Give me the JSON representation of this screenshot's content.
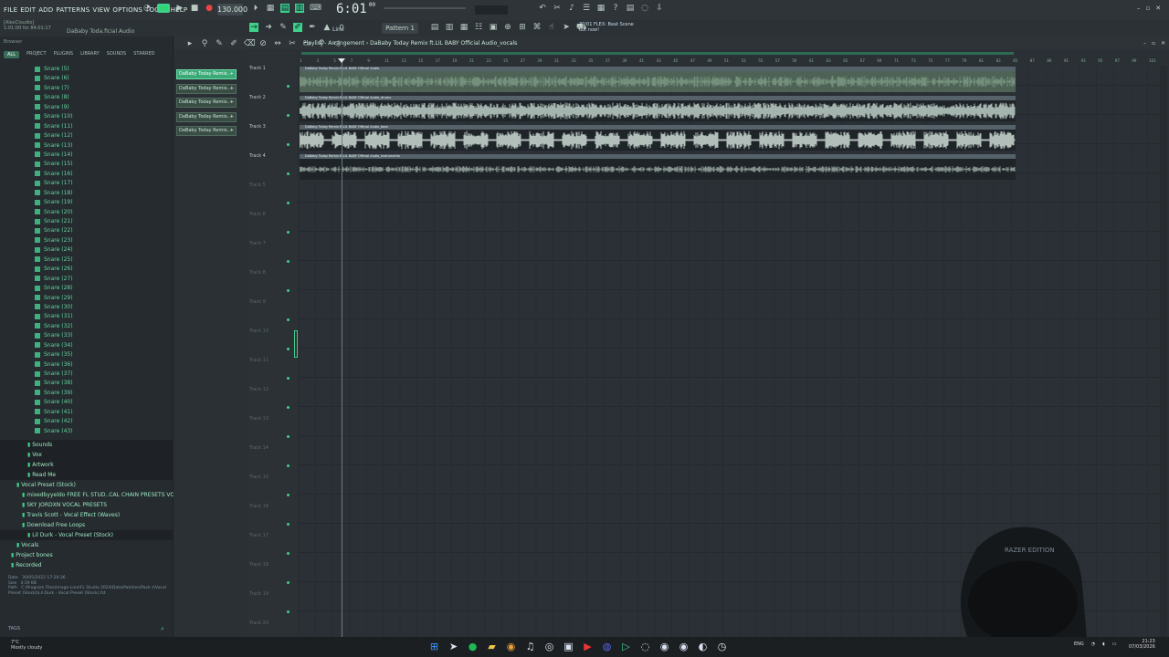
{
  "menu": [
    "FILE",
    "EDIT",
    "ADD",
    "PATTERNS",
    "VIEW",
    "OPTIONS",
    "TOOLS",
    "HELP"
  ],
  "tempo": "130.000",
  "clock": "6:01",
  "clock_sub": "00",
  "song_info": {
    "line1": "[AlexCloudio]",
    "line2": "1:01:00 for 84:01:17"
  },
  "song_name": "DaBaby Toda.ficial Audio",
  "pattern": "Pattern 1",
  "line_mode": "Line",
  "hint": {
    "line1": "30/01 FLEX: Beat Scene",
    "line2": "out now!"
  },
  "browser": {
    "title": "Browser",
    "tabs": [
      "ALL",
      "PROJECT",
      "PLUGINS",
      "LIBRARY",
      "SOUNDS",
      "STARRED"
    ],
    "snares": [
      "Snare (5)",
      "Snare (6)",
      "Snare (7)",
      "Snare (8)",
      "Snare (9)",
      "Snare (10)",
      "Snare (11)",
      "Snare (12)",
      "Snare (13)",
      "Snare (14)",
      "Snare (15)",
      "Snare (16)",
      "Snare (17)",
      "Snare (18)",
      "Snare (19)",
      "Snare (20)",
      "Snare (21)",
      "Snare (22)",
      "Snare (23)",
      "Snare (24)",
      "Snare (25)",
      "Snare (26)",
      "Snare (27)",
      "Snare (28)",
      "Snare (29)",
      "Snare (30)",
      "Snare (31)",
      "Snare (32)",
      "Snare (33)",
      "Snare (34)",
      "Snare (35)",
      "Snare (36)",
      "Snare (37)",
      "Snare (38)",
      "Snare (39)",
      "Snare (40)",
      "Snare (41)",
      "Snare (42)",
      "Snare (43)"
    ],
    "folders": [
      {
        "label": "Sounds",
        "indent": 30
      },
      {
        "label": "Vox",
        "indent": 30
      },
      {
        "label": "Artwork",
        "indent": 30
      },
      {
        "label": "Read Me",
        "indent": 30
      },
      {
        "label": "Vocal Preset (Stock)",
        "indent": 18
      },
      {
        "label": "mixedbyyeldo FREE FL STUD..CAL CHAIN PRESETS VOL. 2",
        "indent": 24
      },
      {
        "label": "SKY JORDXN VOCAL PRESETS",
        "indent": 24
      },
      {
        "label": "Travis Scott - Vocal Effect (Waves)",
        "indent": 24
      },
      {
        "label": "Download Free Loops",
        "indent": 24
      },
      {
        "label": "Lil Durk - Vocal Preset (Stock)",
        "indent": 30
      },
      {
        "label": "Vocals",
        "indent": 18
      },
      {
        "label": "Project bones",
        "indent": 12
      },
      {
        "label": "Recorded",
        "indent": 12
      }
    ],
    "file_info": {
      "date": "30/05/2022 17:29:36",
      "size": "4.59 KB",
      "path": "C:\\Program Files\\Image-Line\\FL Studio 2024\\Data\\Patches\\Pack s\\Vocal Preset (Stock)\\Lil Durk - Vocal Preset (Stock).fst"
    },
    "tags": "TAGS"
  },
  "clips": [
    "DaBaby Today Remix..",
    "DaBaby Today Remix..",
    "DaBaby Today Remix..",
    "DaBaby Today Remix..",
    "DaBaby Today Remix.."
  ],
  "playlist_title": "Playlist - Arrangement › DaBaby Today Remix ft.LIL BABY Official Audio_vocals",
  "tracks": [
    "Track 1",
    "Track 2",
    "Track 3",
    "Track 4",
    "Track 5",
    "Track 6",
    "Track 7",
    "Track 8",
    "Track 9",
    "Track 10",
    "Track 11",
    "Track 12",
    "Track 13",
    "Track 14",
    "Track 15",
    "Track 16",
    "Track 17",
    "Track 18",
    "Track 19",
    "Track 20"
  ],
  "lanes": [
    {
      "label": "DaBaby Today Remix ft.LIL BABY Official Audio",
      "color": "#7f9a86",
      "density": 0.6
    },
    {
      "label": "DaBaby Today Remix ft.LIL BABY Official Audio_drums",
      "color": "#c7d9d0",
      "density": 0.85
    },
    {
      "label": "DaBaby Today Remix ft.LIL BABY Official Audio_bass",
      "color": "#d8e6df",
      "density": 1.0
    },
    {
      "label": "DaBaby Today Remix ft.LIL BABY Official Audio_instruments",
      "color": "#9fb0a8",
      "density": 0.35
    }
  ],
  "ruler_start": 1,
  "weather": {
    "temp": "7°C",
    "desc": "Mostly cloudy"
  },
  "tray": {
    "lang": "ENG"
  },
  "datetime": {
    "time": "21:23",
    "date": "07/03/2026"
  },
  "cam_text": "RAZER EDITION",
  "colors": {
    "accent": "#3fd08a",
    "clip_selected": "#3aa877"
  }
}
